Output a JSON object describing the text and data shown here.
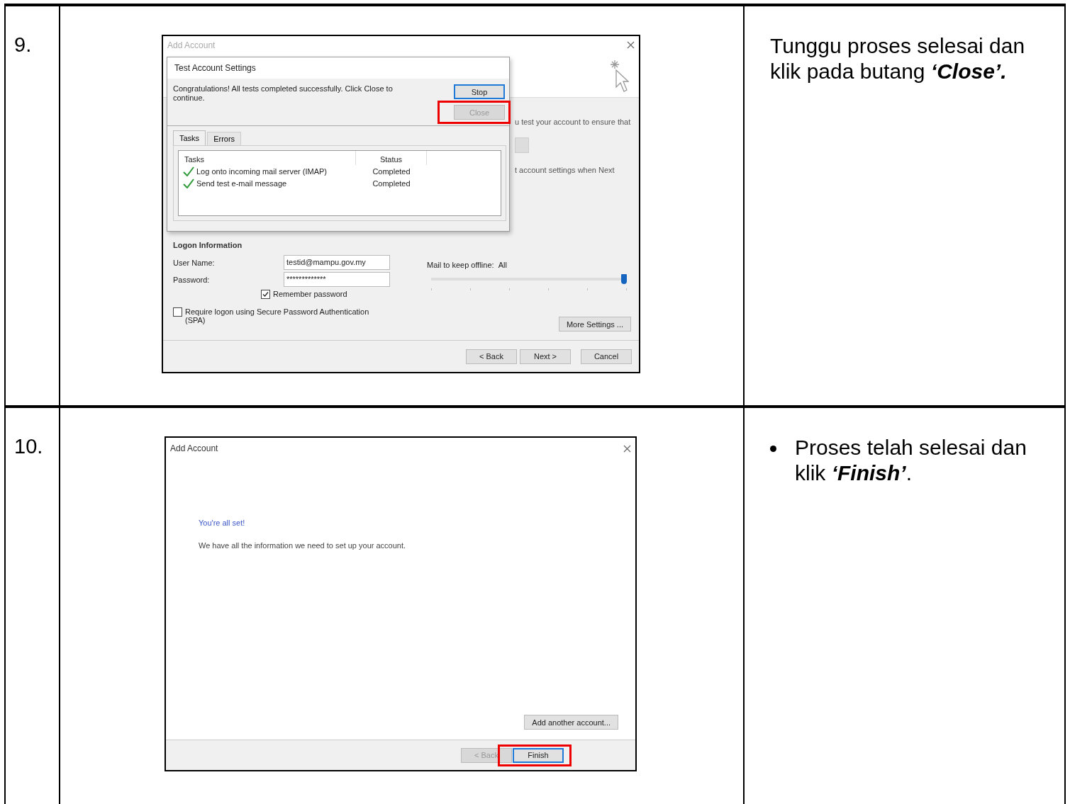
{
  "steps": [
    {
      "number": "9.",
      "instruction": {
        "bulleted": false,
        "text": "Tunggu proses selesai dan klik pada butang ",
        "emphasis": "‘Close’."
      },
      "screenshot": {
        "kind": "test_settings",
        "title": "Add Account",
        "behind_lines": [
          "u test your account to ensure that",
          "t account settings when Next"
        ],
        "logon": {
          "heading": "Logon Information",
          "fields": [
            {
              "label": "User Name:",
              "value": "testid@mampu.gov.my"
            },
            {
              "label": "Password:",
              "value": "*************"
            }
          ],
          "remember": {
            "label": "Remember password",
            "checked": true
          },
          "spa": {
            "label": "Require logon using Secure Password Authentication (SPA)",
            "checked": false
          }
        },
        "offline": {
          "label": "Mail to keep offline:",
          "value": "All",
          "level": 1
        },
        "more_button": "More Settings ...",
        "buttons": [
          {
            "label": "< Back",
            "disabled": false,
            "focused": false
          },
          {
            "label": "Next >",
            "disabled": false,
            "focused": false
          },
          {
            "label": "Cancel",
            "disabled": false,
            "focused": false
          }
        ],
        "dialog": {
          "title": "Test Account Settings",
          "message": "Congratulations! All tests completed successfully. Click Close to continue.",
          "buttons": [
            {
              "label": "Stop",
              "disabled": false,
              "focused": true,
              "highlighted": false
            },
            {
              "label": "Close",
              "disabled": true,
              "focused": false,
              "highlighted": true
            }
          ],
          "tabs": [
            {
              "label": "Tasks",
              "selected": true
            },
            {
              "label": "Errors",
              "selected": false
            }
          ],
          "columns": [
            "Tasks",
            "Status"
          ],
          "tasks": [
            {
              "name": "Log onto incoming mail server (IMAP)",
              "status": "Completed",
              "done": true
            },
            {
              "name": "Send test e-mail message",
              "status": "Completed",
              "done": true
            }
          ]
        }
      }
    },
    {
      "number": "10.",
      "instruction": {
        "bulleted": true,
        "text": "Proses telah selesai dan klik ",
        "emphasis": "‘Finish’",
        "tail": "."
      },
      "screenshot": {
        "kind": "complete",
        "title": "Add Account",
        "heading": "You're all set!",
        "message": "We have all the information we need to set up your account.",
        "add_button": "Add another account...",
        "buttons": [
          {
            "label": "< Back",
            "disabled": true,
            "focused": false,
            "highlighted": false
          },
          {
            "label": "Finish",
            "disabled": false,
            "focused": true,
            "highlighted": true
          }
        ]
      }
    }
  ]
}
